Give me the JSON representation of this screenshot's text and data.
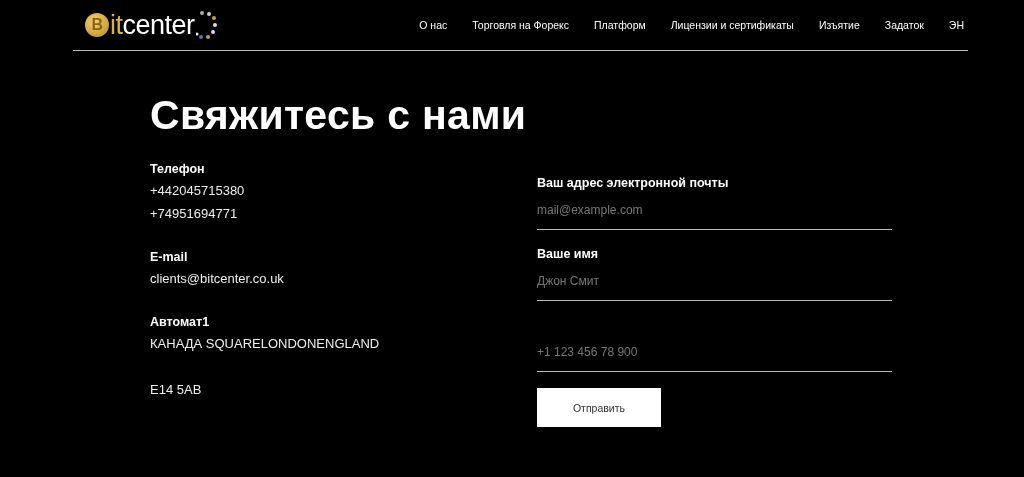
{
  "logo": {
    "coin_letter": "B",
    "accent": "it",
    "rest": "center"
  },
  "nav": [
    {
      "label": "О нас"
    },
    {
      "label": "Торговля на Форекс"
    },
    {
      "label": "Платформ"
    },
    {
      "label": "Лицензии и сертификаты"
    },
    {
      "label": "Изъятие"
    },
    {
      "label": "Задаток"
    },
    {
      "label": "ЭН"
    }
  ],
  "heading": "Свяжитесь с нами",
  "contacts": [
    {
      "title": "Телефон",
      "lines": [
        "+442045715380",
        "+74951694771"
      ]
    },
    {
      "title": "E-mail",
      "lines": [
        "clients@bitcenter.co.uk"
      ]
    },
    {
      "title": "Автомат1",
      "lines": [
        "КАНАДА SQUARELONDONENGLAND"
      ],
      "postcode": "E14 5AB"
    }
  ],
  "form": {
    "fields": [
      {
        "label": "Ваш адрес электронной почты",
        "placeholder": "mail@example.com"
      },
      {
        "label": "Ваше имя",
        "placeholder": "Джон Смит"
      },
      {
        "placeholder": "+1 123 456 78 900"
      }
    ],
    "submit": "Отправить"
  }
}
